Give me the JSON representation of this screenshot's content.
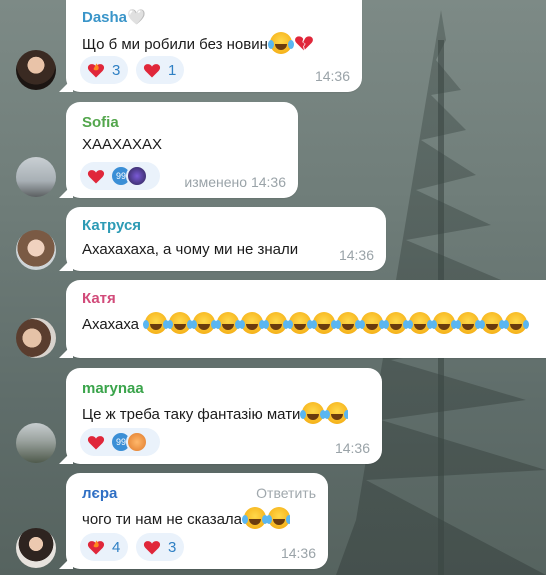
{
  "colors": {
    "name_dasha": "#3a95c9",
    "name_sofia": "#53a64c",
    "name_katrusia": "#2d9bb5",
    "name_katia": "#d24b7a",
    "name_marynaa": "#3aa44b",
    "name_lera": "#2f6fc4",
    "reaction_bg": "#eaf2fb",
    "reaction_count": "#2f80c4"
  },
  "messages": [
    {
      "name": "Dasha🤍",
      "text": "Що б ми робили без новин",
      "emoji_suffix": [
        "face-with-tears-of-joy",
        "broken-heart"
      ],
      "reactions": [
        {
          "icon": "heart-on-fire-icon",
          "count": "3"
        },
        {
          "icon": "red-heart-icon",
          "count": "1"
        }
      ],
      "time": "14:36"
    },
    {
      "name": "Sofia",
      "text": "ХААХАХАХ",
      "reactions": [
        {
          "icon": "red-heart-icon",
          "count": ""
        },
        {
          "icon": "reactor-avatars",
          "count": ""
        }
      ],
      "edited_label": "изменено",
      "time": "14:36"
    },
    {
      "name": "Катруся",
      "text": "Ахахахаха, а чому ми не знали",
      "time": "14:36"
    },
    {
      "name": "Катя",
      "text": "Ахахаха",
      "emoji_suffix_count": 16
    },
    {
      "name": "marynaa",
      "text": "Це ж треба таку фантазію мати",
      "emoji_suffix": [
        "face-with-tears-of-joy",
        "face-with-tears-of-joy"
      ],
      "reactions": [
        {
          "icon": "red-heart-icon",
          "count": ""
        },
        {
          "icon": "reactor-avatars",
          "count": ""
        }
      ],
      "time": "14:36"
    },
    {
      "name": "лєра",
      "reply_label": "Ответить",
      "text": "чого ти нам не сказала",
      "emoji_suffix": [
        "face-with-tears-of-joy",
        "face-with-tears-of-joy"
      ],
      "reactions": [
        {
          "icon": "heart-on-fire-icon",
          "count": "4"
        },
        {
          "icon": "red-heart-icon",
          "count": "3"
        }
      ],
      "time": "14:36"
    }
  ]
}
